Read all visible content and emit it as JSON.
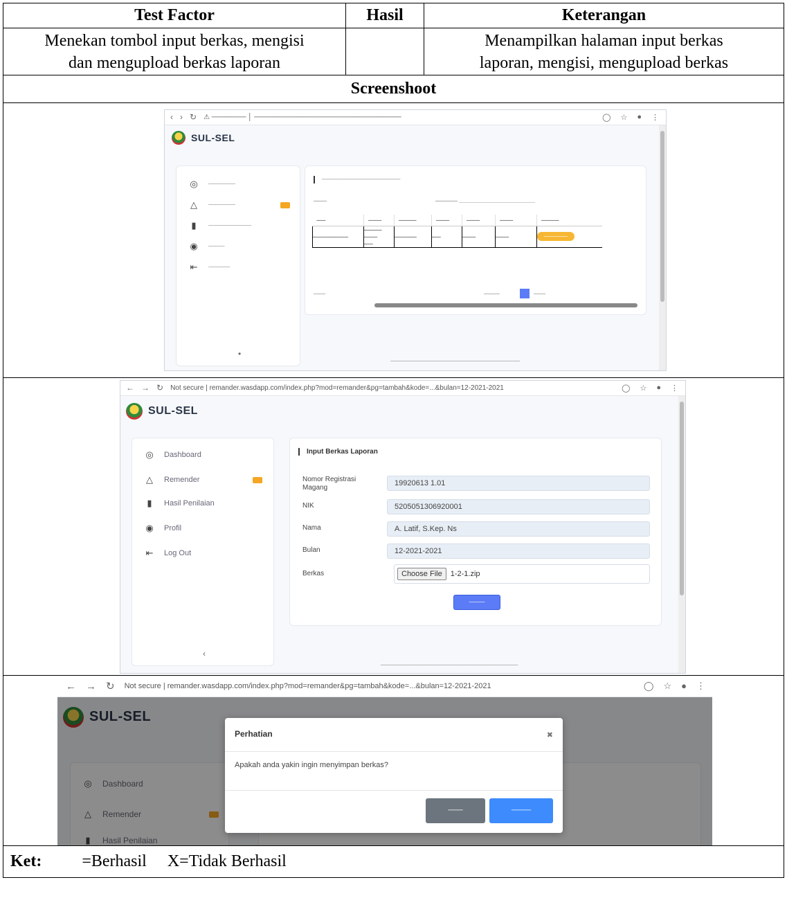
{
  "header": {
    "col1": "Test Factor",
    "col2": "Hasil",
    "col3": "Keterangan"
  },
  "row": {
    "factor_line1": "Menekan tombol input berkas, mengisi",
    "factor_line2": "dan mengupload berkas laporan",
    "hasil": "",
    "keterangan_line1": "Menampilkan halaman input berkas",
    "keterangan_line2": "laporan, mengisi, mengupload berkas"
  },
  "screenshot_label": "Screenshoot",
  "app": {
    "brand": "SUL-SEL"
  },
  "shot2": {
    "url": "Not secure | remander.wasdapp.com/index.php?mod=remander&pg=tambah&kode=...&bulan=12-2021-2021",
    "sidebar": [
      "Dashboard",
      "Remender",
      "Hasil Penilaian",
      "Profil",
      "Log Out"
    ],
    "card_title": "Input Berkas Laporan",
    "labels": {
      "nrm_1": "Nomor Registrasi",
      "nrm_2": "Magang",
      "nik": "NIK",
      "nama": "Nama",
      "bulan": "Bulan",
      "berkas": "Berkas"
    },
    "values": {
      "nrm": "19920613 1.01",
      "nik": "5205051306920001",
      "nama": "A. Latif, S.Kep. Ns",
      "bulan": "12-2021-2021"
    },
    "file_button": "Choose File",
    "file_name": "1-2-1.zip"
  },
  "shot3": {
    "url": "Not secure | remander.wasdapp.com/index.php?mod=remander&pg=tambah&kode=...&bulan=12-2021-2021",
    "sidebar": [
      "Dashboard",
      "Remender",
      "Hasil Penilaian"
    ],
    "modal_title": "Perhatian",
    "modal_message": "Apakah anda yakin ingin menyimpan berkas?"
  },
  "ket": {
    "label": "Ket:",
    "berhasil": "=Berhasil",
    "tidak": "X=Tidak Berhasil"
  }
}
